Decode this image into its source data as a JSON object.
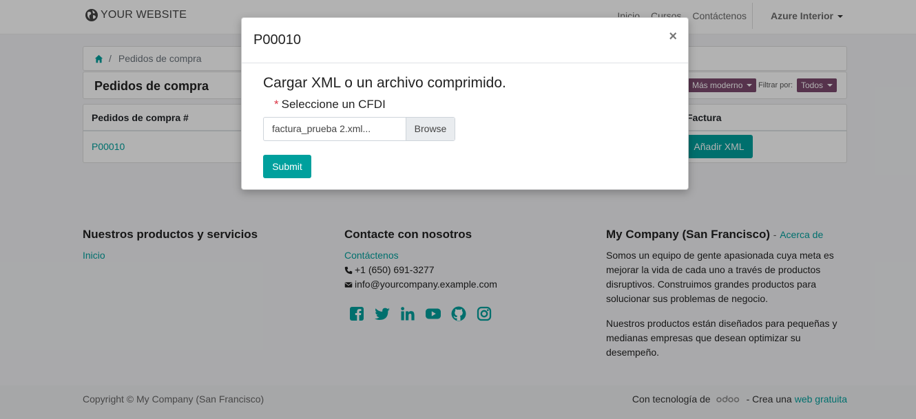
{
  "header": {
    "brand": "YOUR WEBSITE",
    "nav": [
      "Inicio",
      "Cursos",
      "Contáctenos"
    ],
    "user": "Azure Interior"
  },
  "breadcrumb": {
    "current": "Pedidos de compra"
  },
  "page": {
    "title": "Pedidos de compra",
    "sort_label": "Más moderno",
    "filter_label": "Filtrar por:",
    "filter_value": "Todos"
  },
  "table": {
    "col_order": "Pedidos de compra #",
    "col_invoice": "Factura",
    "rows": [
      {
        "order": "P00010",
        "action": "Añadir XML"
      }
    ]
  },
  "footer": {
    "col1": {
      "title": "Nuestros productos y servicios",
      "link": "Inicio"
    },
    "col2": {
      "title": "Contacte con nosotros",
      "link": "Contáctenos",
      "phone": "+1 (650) 691-3277",
      "email": "info@yourcompany.example.com"
    },
    "col3": {
      "title": "My Company (San Francisco)",
      "about": "Acerca de",
      "p1": "Somos un equipo de gente apasionada cuya meta es mejorar la vida de cada uno a través de productos disruptivos. Construimos grandes productos para solucionar sus problemas de negocio.",
      "p2": "Nuestros productos están diseñados para pequeñas y medianas empresas que desean optimizar su desempeño."
    },
    "socials": [
      "facebook-icon",
      "twitter-icon",
      "linkedin-icon",
      "youtube-icon",
      "github-icon",
      "instagram-icon"
    ]
  },
  "copyright": {
    "text": "Copyright © My Company (San Francisco)",
    "powered": "Con tecnología de",
    "odoo": "odoo",
    "create": "- Crea una",
    "link": "web gratuita"
  },
  "modal": {
    "title": "P00010",
    "heading": "Cargar XML o un archivo comprimido.",
    "field_label": "Seleccione un CFDI",
    "required_mark": "*",
    "file_name": "factura_prueba 2.xml...",
    "browse": "Browse",
    "submit": "Submit",
    "close": "×"
  },
  "colors": {
    "accent": "#00a09d",
    "secondary": "#7c4a6e"
  }
}
